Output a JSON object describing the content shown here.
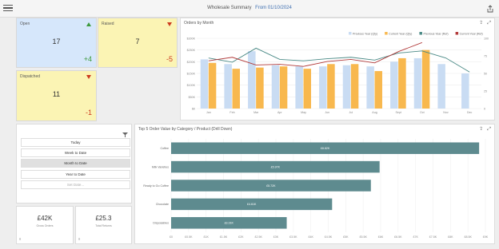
{
  "header": {
    "title": "Wholesale Summary",
    "date": "From 01/10/2024"
  },
  "kpis": {
    "open": {
      "label": "Open",
      "value": "17",
      "delta": "+4",
      "trend": "up",
      "bg": "#d6e7fb",
      "delta_color": "#3c9a3c"
    },
    "raised": {
      "label": "Raised",
      "value": "7",
      "delta": "-5",
      "trend": "down",
      "bg": "#fbf4b4",
      "delta_color": "#cc3b1f"
    },
    "dispatched": {
      "label": "Dispatched",
      "value": "11",
      "delta": "-1",
      "trend": "down",
      "bg": "#fbf4b4",
      "delta_color": "#cc3b1f"
    }
  },
  "orders_chart": {
    "title": "Orders by Month",
    "chart_data": {
      "type": "bar",
      "categories": [
        "Jan",
        "Feb",
        "Mar",
        "Apr",
        "May",
        "Jun",
        "Jul",
        "Aug",
        "Sept",
        "Oct",
        "Nov",
        "Dec"
      ],
      "series": [
        {
          "name": "Previous Year (Qty)",
          "kind": "bar",
          "axis": "left",
          "color": "#c9dcf3",
          "values": [
            210,
            190,
            245,
            185,
            180,
            180,
            185,
            180,
            200,
            215,
            190,
            150
          ]
        },
        {
          "name": "Current Year (Qty)",
          "kind": "bar",
          "axis": "left",
          "color": "#f8b84e",
          "values": [
            195,
            170,
            175,
            180,
            170,
            190,
            190,
            160,
            215,
            250,
            null,
            null
          ]
        },
        {
          "name": "Previous Year (Ref)",
          "kind": "line",
          "axis": "right",
          "color": "#4a8a86",
          "values": [
            72,
            66,
            86,
            70,
            68,
            71,
            73,
            69,
            79,
            82,
            72,
            52
          ]
        },
        {
          "name": "Current Year (Ref)",
          "kind": "line",
          "axis": "right",
          "color": "#b23a3a",
          "values": [
            68,
            73,
            62,
            63,
            60,
            67,
            70,
            65,
            81,
            94,
            null,
            null
          ]
        }
      ],
      "left_ticks": [
        "$0",
        "$50K",
        "$100K",
        "$150K",
        "$200K",
        "$250K",
        "$300K"
      ],
      "right_ticks": [
        "0",
        "25",
        "50",
        "75",
        "100"
      ],
      "ylim_left": [
        0,
        300
      ],
      "ylim_right": [
        0,
        100
      ],
      "legend": "top-right",
      "grid": true
    }
  },
  "filters": {
    "items": [
      "Today",
      "Week to Date",
      "Month to Date",
      "Year to Date",
      "Set Date..."
    ],
    "active_index": 2,
    "muted_index": 4
  },
  "stats": {
    "orders": {
      "value": "£42K",
      "label": "Gross Orders",
      "corner": "≡"
    },
    "returns": {
      "value": "£25.3",
      "label": "Total Returns",
      "corner": "≡"
    }
  },
  "category_chart": {
    "title": "Top 5 Order Value by Category / Product (Drill Down)",
    "chart_data": {
      "type": "bar",
      "orientation": "horizontal",
      "categories": [
        "Coffee",
        "Milk Varieties",
        "Ready to Go Coffee",
        "Chocolate",
        "Disposables"
      ],
      "values": [
        8.82,
        5.97,
        5.72,
        4.61,
        3.31
      ],
      "value_labels": [
        "£8.82K",
        "£5.97K",
        "£5.72K",
        "£4.61K",
        "£3.31K"
      ],
      "x_ticks": [
        "£0",
        "£0.5K",
        "£1K",
        "£1.5K",
        "£2K",
        "£2.5K",
        "£3K",
        "£3.5K",
        "£4K",
        "£4.5K",
        "£5K",
        "£5.5K",
        "£6K",
        "£6.5K",
        "£7K",
        "£7.5K",
        "£8K",
        "£8.5K",
        "£9K"
      ],
      "xlim": [
        0,
        9
      ],
      "color": "#5e8b8f"
    }
  }
}
